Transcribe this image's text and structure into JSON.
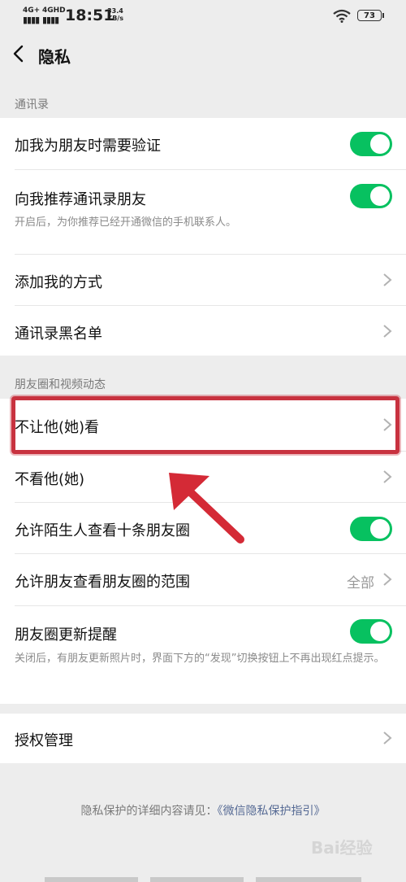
{
  "status_bar": {
    "signal1": "4G+",
    "signal2": "4GHD",
    "time": "18:51",
    "speed_value": "33.4",
    "speed_unit": "KB/s",
    "battery": "73"
  },
  "nav": {
    "back_icon": "chevron-left-icon",
    "title": "隐私"
  },
  "contacts": {
    "header": "通讯录",
    "items": [
      {
        "label": "加我为朋友时需要验证",
        "control": "toggle",
        "on": true
      },
      {
        "label": "向我推荐通讯录朋友",
        "control": "toggle",
        "on": true,
        "desc": "开启后，为你推荐已经开通微信的手机联系人。"
      },
      {
        "label": "添加我的方式",
        "control": "chevron"
      },
      {
        "label": "通讯录黑名单",
        "control": "chevron"
      }
    ]
  },
  "moments": {
    "header": "朋友圈和视频动态",
    "items": [
      {
        "label": "不让他(她)看",
        "control": "chevron"
      },
      {
        "label": "不看他(她)",
        "control": "chevron"
      },
      {
        "label": "允许陌生人查看十条朋友圈",
        "control": "toggle",
        "on": true
      },
      {
        "label": "允许朋友查看朋友圈的范围",
        "control": "chevron",
        "value": "全部"
      },
      {
        "label": "朋友圈更新提醒",
        "control": "toggle",
        "on": true,
        "desc": "关闭后，有朋友更新照片时，界面下方的“发现”切换按钮上不再出现红点提示。"
      }
    ]
  },
  "auth": {
    "label": "授权管理",
    "control": "chevron"
  },
  "footer": {
    "text": "隐私保护的详细内容请见：",
    "link": "《微信隐私保护指引》"
  },
  "watermark": "Bai经验",
  "colors": {
    "accent_green": "#07c160",
    "link_blue": "#576b95",
    "highlight_red": "#c8323f",
    "background": "#ededed"
  },
  "annotation": {
    "icon": "red-arrow-annotation"
  }
}
